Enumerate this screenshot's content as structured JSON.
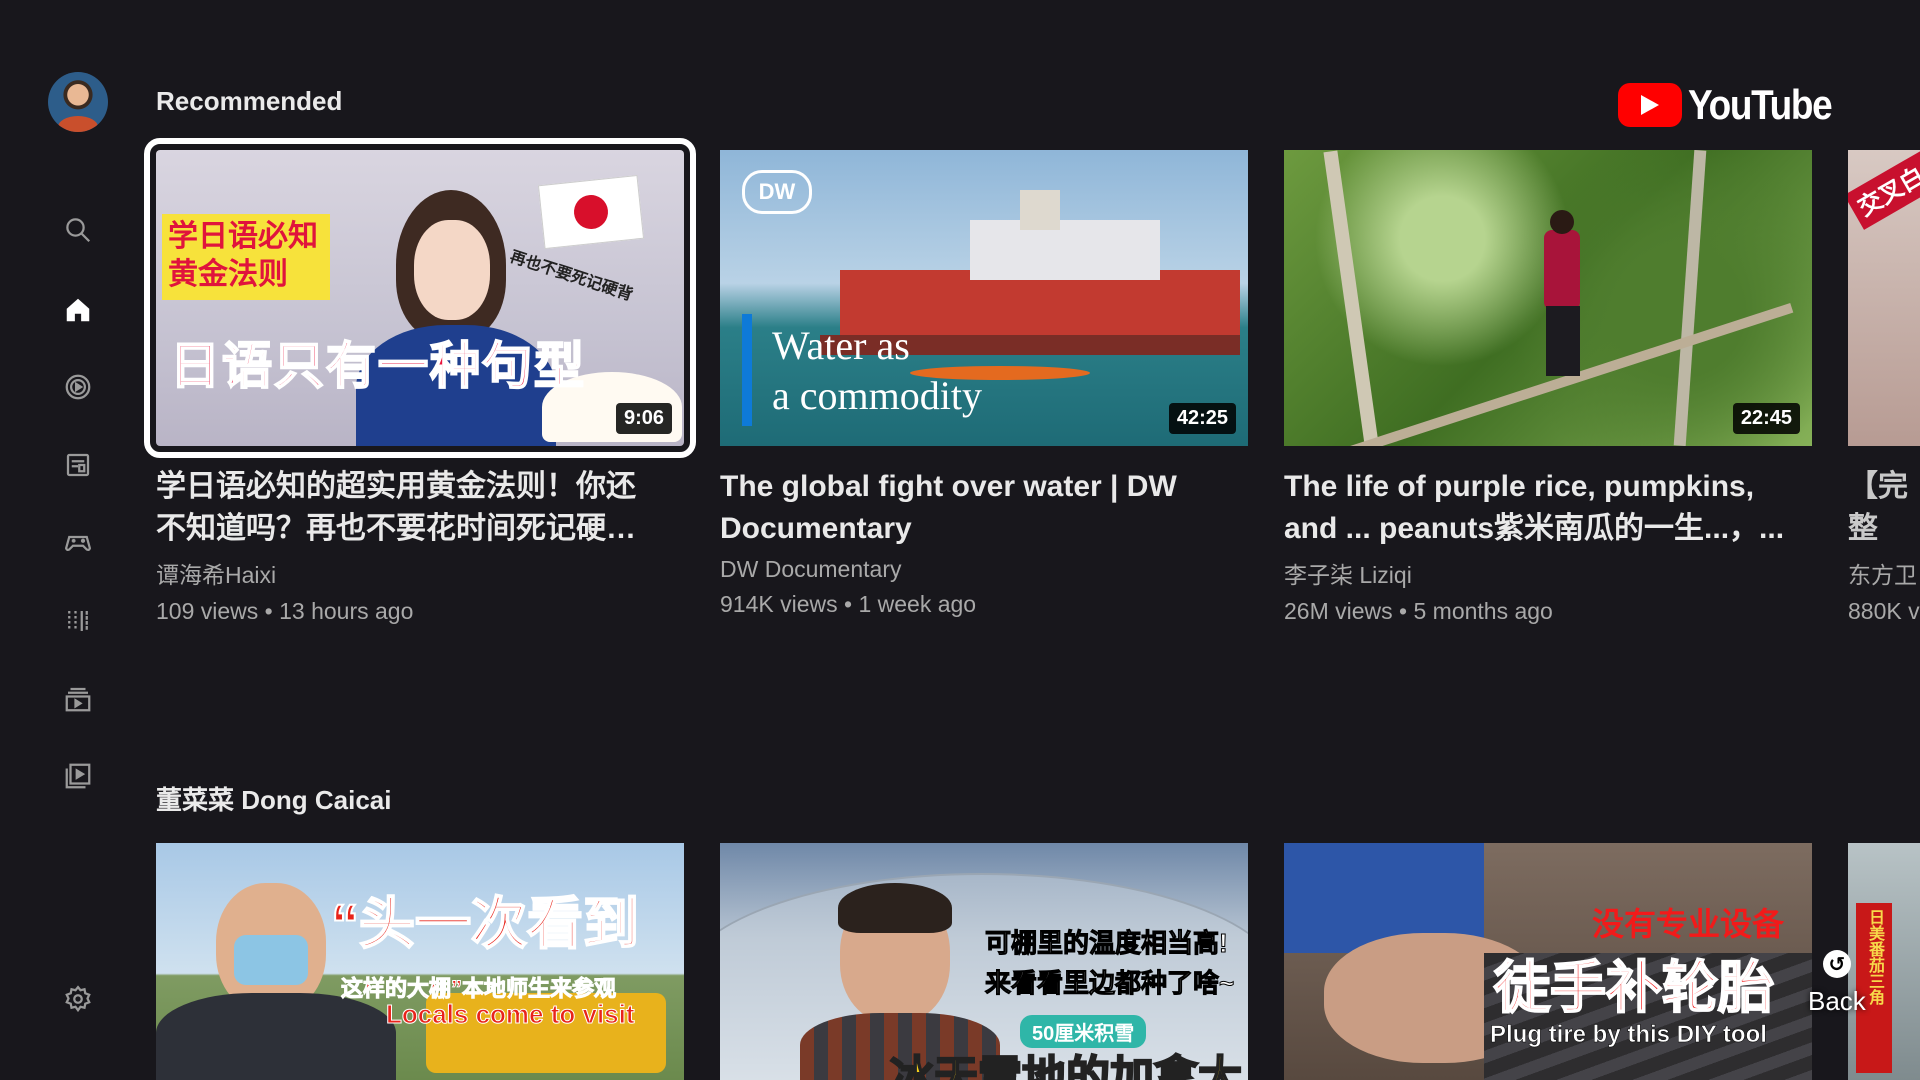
{
  "app": {
    "logo_text": "YouTube",
    "accent": "#ff0000",
    "background": "#18171c"
  },
  "sidebar": {
    "items": [
      {
        "name": "search",
        "icon": "search-icon"
      },
      {
        "name": "home",
        "icon": "home-icon",
        "active": true
      },
      {
        "name": "shorts",
        "icon": "play-circle-icon"
      },
      {
        "name": "subscriptions",
        "icon": "subscriptions-icon"
      },
      {
        "name": "gaming",
        "icon": "gamepad-icon"
      },
      {
        "name": "music",
        "icon": "music-bars-icon"
      },
      {
        "name": "library",
        "icon": "library-icon"
      },
      {
        "name": "your-videos",
        "icon": "video-library-icon"
      },
      {
        "name": "settings",
        "icon": "gear-icon"
      }
    ]
  },
  "sections": [
    {
      "title": "Recommended",
      "videos": [
        {
          "title": "学日语必知的超实用黄金法则！你还\n不知道吗？再也不要花时间死记硬…",
          "channel": "谭海希Haixi",
          "meta": "109 views • 13 hours ago",
          "duration": "9:06",
          "thumb_text": {
            "box1": "学日语必知",
            "box2": "黄金法则",
            "main": "日语只有一种句型",
            "side": "再也不要死记硬背"
          },
          "focused": true
        },
        {
          "title": "The global fight over water | DW\nDocumentary",
          "channel": "DW Documentary",
          "meta": "914K views • 1 week ago",
          "duration": "42:25",
          "thumb_text": {
            "brand": "DW",
            "line1": "Water as",
            "line2": "a commodity"
          }
        },
        {
          "title": "The life of purple rice, pumpkins,\nand ... peanuts紫米南瓜的一生...，...",
          "channel": "李子柒 Liziqi",
          "meta": "26M views • 5 months ago",
          "duration": "22:45"
        },
        {
          "title": "【完整\n记录",
          "channel": "东方卫",
          "meta": "880K v",
          "thumb_text": {
            "main": "交叉白"
          }
        }
      ]
    },
    {
      "title": "董菜菜 Dong Caicai",
      "videos": [
        {
          "thumb_text": {
            "main": "“头一次看到",
            "sub": "这样的大棚”本地师生来参观",
            "en": "Locals come to visit"
          }
        },
        {
          "thumb_text": {
            "line1": "可棚里的温度相当高!",
            "line2": "来看看里边都种了啥~",
            "tag": "50厘米积雪",
            "main": "冰天雪地的加拿大"
          }
        },
        {
          "thumb_text": {
            "top": "没有专业设备",
            "main": "徒手补轮胎",
            "en": "Plug tire by this DIY tool"
          }
        },
        {
          "thumb_text": {
            "side": "日美番茄三角"
          }
        }
      ]
    }
  ],
  "back": {
    "label": "Back"
  }
}
